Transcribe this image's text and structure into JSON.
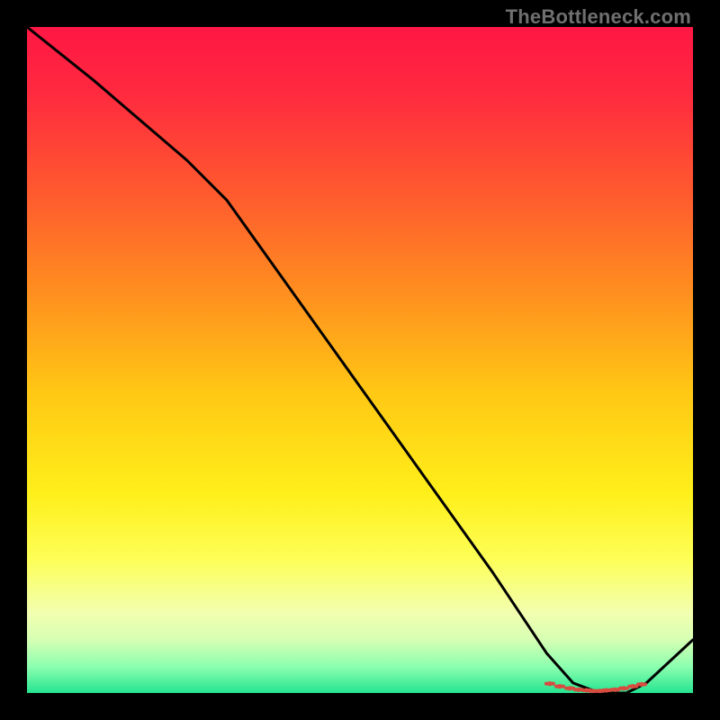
{
  "watermark": "TheBottleneck.com",
  "gradient_stops": [
    {
      "offset": 0.0,
      "color": "#ff1744"
    },
    {
      "offset": 0.1,
      "color": "#ff2a3f"
    },
    {
      "offset": 0.25,
      "color": "#ff5a2e"
    },
    {
      "offset": 0.4,
      "color": "#ff8f1f"
    },
    {
      "offset": 0.55,
      "color": "#ffc814"
    },
    {
      "offset": 0.7,
      "color": "#ffef1a"
    },
    {
      "offset": 0.8,
      "color": "#fdff58"
    },
    {
      "offset": 0.88,
      "color": "#f2ffb0"
    },
    {
      "offset": 0.92,
      "color": "#d6ffb3"
    },
    {
      "offset": 0.96,
      "color": "#8dffb0"
    },
    {
      "offset": 1.0,
      "color": "#25e490"
    }
  ],
  "chart_data": {
    "type": "line",
    "title": "",
    "xlabel": "",
    "ylabel": "",
    "xlim": [
      0,
      100
    ],
    "ylim": [
      0,
      100
    ],
    "grid": false,
    "series": [
      {
        "name": "curve",
        "x": [
          0,
          10,
          24,
          30,
          40,
          50,
          60,
          70,
          78,
          82,
          86,
          90,
          93,
          100
        ],
        "values": [
          100,
          92,
          80,
          74,
          60,
          46,
          32,
          18,
          6,
          1.5,
          0,
          0,
          1.5,
          8
        ]
      }
    ],
    "markers": {
      "name": "highlight-cluster",
      "color": "#d94a3f",
      "x": [
        78.5,
        80.0,
        81.5,
        82.8,
        84.0,
        85.0,
        86.0,
        87.0,
        88.3,
        89.6,
        91.0,
        92.3
      ],
      "values": [
        1.4,
        1.0,
        0.7,
        0.5,
        0.4,
        0.3,
        0.3,
        0.4,
        0.5,
        0.7,
        1.0,
        1.3
      ]
    }
  }
}
